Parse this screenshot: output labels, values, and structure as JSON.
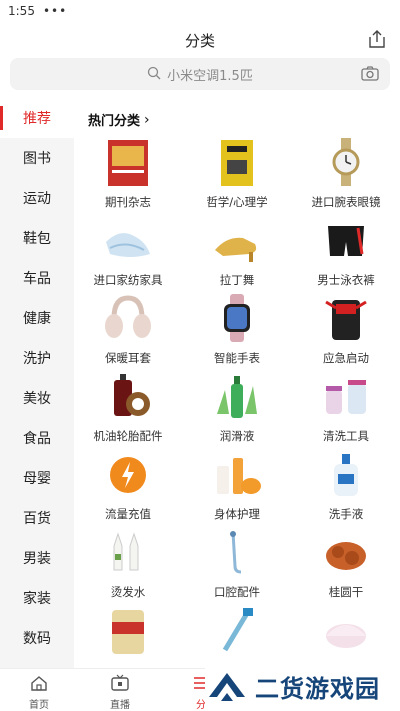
{
  "status": {
    "time": "1:55",
    "dots": "•••"
  },
  "header": {
    "title": "分类"
  },
  "search": {
    "placeholder": "小米空调1.5匹"
  },
  "sidebar": {
    "items": [
      {
        "label": "推荐",
        "active": true
      },
      {
        "label": "图书"
      },
      {
        "label": "运动"
      },
      {
        "label": "鞋包"
      },
      {
        "label": "车品"
      },
      {
        "label": "健康"
      },
      {
        "label": "洗护"
      },
      {
        "label": "美妆"
      },
      {
        "label": "食品"
      },
      {
        "label": "母婴"
      },
      {
        "label": "百货"
      },
      {
        "label": "男装"
      },
      {
        "label": "家装"
      },
      {
        "label": "数码"
      }
    ]
  },
  "section": {
    "title": "热门分类",
    "chevron": "›"
  },
  "categories": [
    {
      "label": "期刊杂志",
      "icon": "magazine-icon"
    },
    {
      "label": "哲学/心理学",
      "icon": "book-icon"
    },
    {
      "label": "进口腕表眼镜",
      "icon": "watch-icon"
    },
    {
      "label": "进口家纺家具",
      "icon": "textile-icon"
    },
    {
      "label": "拉丁舞",
      "icon": "dance-shoe-icon"
    },
    {
      "label": "男士泳衣裤",
      "icon": "swim-trunks-icon"
    },
    {
      "label": "保暖耳套",
      "icon": "earmuff-icon"
    },
    {
      "label": "智能手表",
      "icon": "smartwatch-icon"
    },
    {
      "label": "应急启动",
      "icon": "jump-starter-icon"
    },
    {
      "label": "机油轮胎配件",
      "icon": "engine-oil-icon"
    },
    {
      "label": "润滑液",
      "icon": "lubricant-icon"
    },
    {
      "label": "清洗工具",
      "icon": "cleaning-tool-icon"
    },
    {
      "label": "流量充值",
      "icon": "lightning-icon"
    },
    {
      "label": "身体护理",
      "icon": "body-care-icon"
    },
    {
      "label": "洗手液",
      "icon": "hand-soap-icon"
    },
    {
      "label": "烫发水",
      "icon": "perm-lotion-icon"
    },
    {
      "label": "口腔配件",
      "icon": "oral-care-icon"
    },
    {
      "label": "桂圆干",
      "icon": "dried-longan-icon"
    },
    {
      "label": "",
      "icon": "milk-powder-icon"
    },
    {
      "label": "",
      "icon": "toothbrush-icon"
    },
    {
      "label": "",
      "icon": "cap-icon"
    }
  ],
  "tabs": [
    {
      "label": "首页",
      "icon": "home-icon"
    },
    {
      "label": "直播",
      "icon": "tv-icon"
    },
    {
      "label": "分",
      "icon": "category-icon",
      "active": true
    }
  ],
  "watermark": {
    "text": "二货游戏园"
  },
  "colors": {
    "accent": "#e02a2a",
    "sidebar_bg": "#f5f5f5",
    "search_bg": "#f2f2f2",
    "watermark": "#16457a"
  }
}
